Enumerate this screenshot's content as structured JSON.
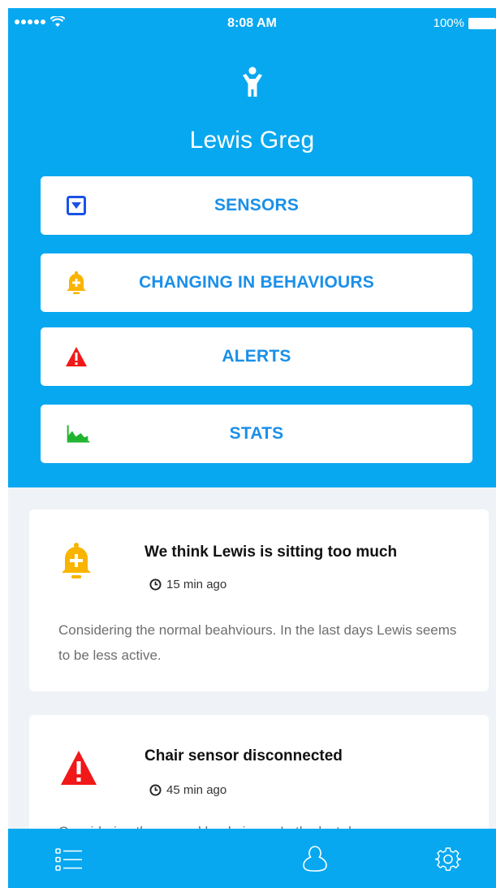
{
  "status_bar": {
    "time": "8:08 AM",
    "battery": "100%",
    "signal_icon": "signal-dots-icon",
    "wifi_icon": "wifi-icon",
    "battery_icon": "battery-icon"
  },
  "profile": {
    "name": "Lewis Greg",
    "icon": "person-icon"
  },
  "menu": [
    {
      "label": "SENSORS",
      "icon": "sensor-box-icon",
      "icon_color": "#1a52e6"
    },
    {
      "label": "CHANGING IN BEHAVIOURS",
      "icon": "bell-plus-icon",
      "icon_color": "#f9b400"
    },
    {
      "label": "ALERTS",
      "icon": "warning-triangle-icon",
      "icon_color": "#f01818"
    },
    {
      "label": "STATS",
      "icon": "area-chart-icon",
      "icon_color": "#1fb32f"
    }
  ],
  "feed": [
    {
      "title": "We think Lewis is sitting too much",
      "time": "15 min ago",
      "body": "Considering the normal beahviours. In the last days Lewis seems to be less active.",
      "icon": "bell-plus-icon"
    },
    {
      "title": "Chair sensor disconnected",
      "time": "45 min ago",
      "body": "Considering the normal beahviours. In the last days",
      "icon": "warning-triangle-icon"
    }
  ],
  "tab_bar": {
    "items": [
      "list-icon",
      "profile-icon",
      "settings-gear-icon"
    ]
  },
  "colors": {
    "primary": "#07a8f0",
    "button_text": "#1a8fe9",
    "background": "#eff3f7"
  }
}
